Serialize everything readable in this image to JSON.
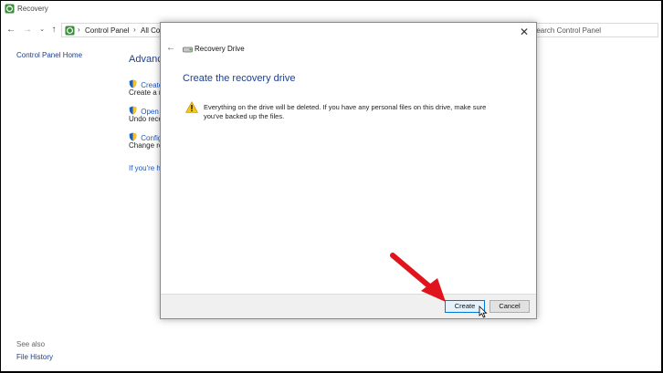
{
  "window": {
    "title": "Recovery",
    "icon": "recovery-icon"
  },
  "navbar": {
    "back_icon": "back-arrow-icon",
    "forward_icon": "forward-arrow-icon",
    "recent_icon": "chevron-down-icon",
    "up_icon": "up-arrow-icon",
    "breadcrumbs": [
      "Control Panel",
      "All Co"
    ],
    "search_placeholder": "Search Control Panel"
  },
  "left_pane": {
    "home_link": "Control Panel Home",
    "see_also": "See also",
    "file_history": "File History"
  },
  "main": {
    "heading": "Advanced recovery tools",
    "tasks": [
      {
        "link": "Create a recovery drive",
        "desc": "Create a recovery drive to troubleshoot problems"
      },
      {
        "link": "Open System Restore",
        "desc": "Undo recent system changes"
      },
      {
        "link": "Configure System Restore",
        "desc": "Change restore settings"
      }
    ],
    "if_link": "If you're having problems with your PC"
  },
  "dialog": {
    "title": "Recovery Drive",
    "heading": "Create the recovery drive",
    "warning": "Everything on the drive will be deleted. If you have any personal files on this drive, make sure you've backed up the files.",
    "create_label": "Create",
    "cancel_label": "Cancel",
    "close_icon": "close-icon"
  },
  "colors": {
    "heading_blue": "#1e3f8f",
    "link_blue": "#1a57c7",
    "arrow_red": "#e0141c",
    "primary_button_border": "#0078d7"
  }
}
